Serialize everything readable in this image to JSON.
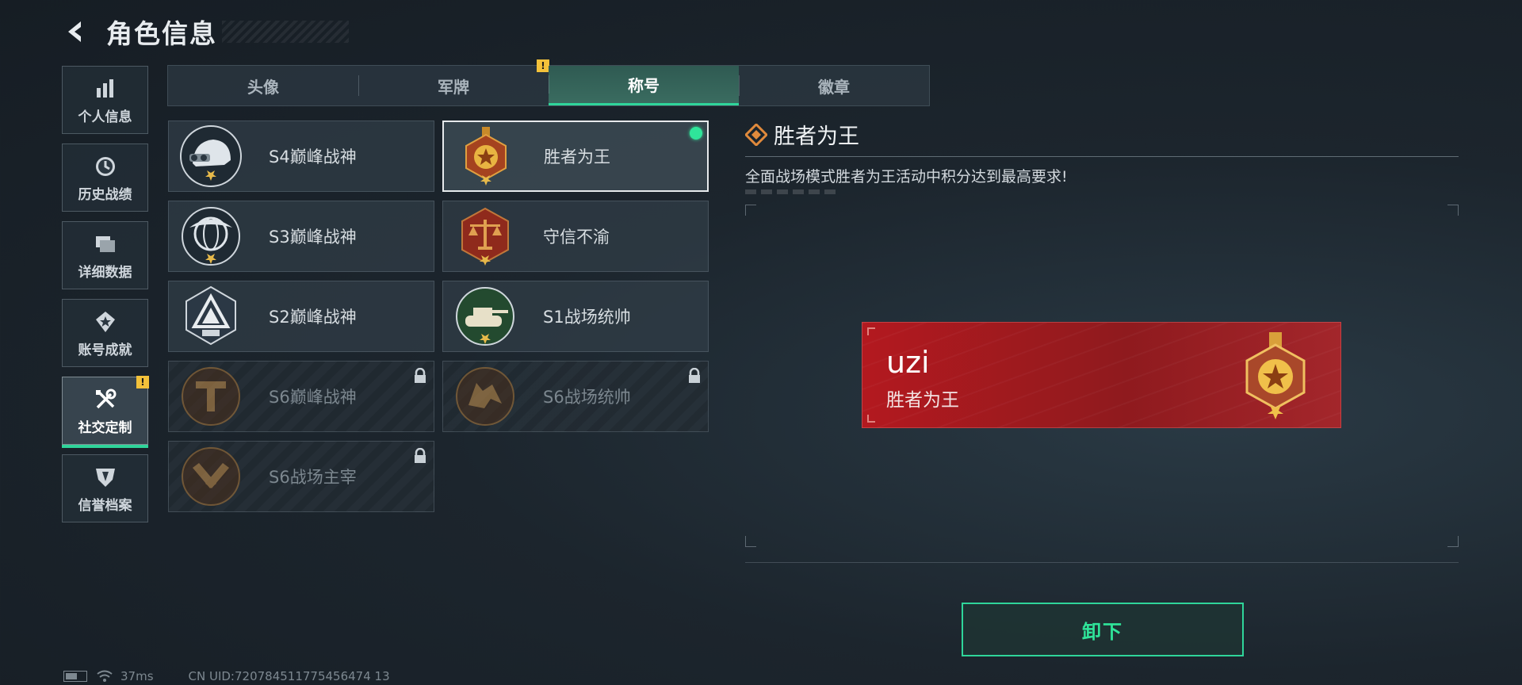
{
  "header": {
    "title": "角色信息"
  },
  "sidenav": {
    "items": [
      {
        "label": "个人信息",
        "icon": "bar-chart-icon",
        "active": false,
        "alert": false
      },
      {
        "label": "历史战绩",
        "icon": "clock-icon",
        "active": false,
        "alert": false
      },
      {
        "label": "详细数据",
        "icon": "folders-icon",
        "active": false,
        "alert": false
      },
      {
        "label": "账号成就",
        "icon": "star-gem-icon",
        "active": false,
        "alert": false
      },
      {
        "label": "社交定制",
        "icon": "tools-icon",
        "active": true,
        "alert": true
      },
      {
        "label": "信誉档案",
        "icon": "shield-icon",
        "active": false,
        "alert": false
      }
    ]
  },
  "tabs": [
    {
      "label": "头像",
      "active": false,
      "alert": false
    },
    {
      "label": "军牌",
      "active": false,
      "alert": true
    },
    {
      "label": "称号",
      "active": true,
      "alert": false
    },
    {
      "label": "徽章",
      "active": false,
      "alert": false
    }
  ],
  "alert_symbol": "!",
  "titles": [
    {
      "label": "S4巅峰战神",
      "emblem": "helmet-emblem-icon",
      "locked": false,
      "selected": false
    },
    {
      "label": "胜者为王",
      "emblem": "gold-medal-emblem-icon",
      "locked": false,
      "selected": true,
      "equipped": true
    },
    {
      "label": "S3巅峰战神",
      "emblem": "globe-eagle-emblem-icon",
      "locked": false,
      "selected": false
    },
    {
      "label": "守信不渝",
      "emblem": "scales-emblem-icon",
      "locked": false,
      "selected": false
    },
    {
      "label": "S2巅峰战神",
      "emblem": "pyramid-emblem-icon",
      "locked": false,
      "selected": false
    },
    {
      "label": "S1战场统帅",
      "emblem": "tank-emblem-icon",
      "locked": false,
      "selected": false
    },
    {
      "label": "S6巅峰战神",
      "emblem": "t-shield-emblem-icon",
      "locked": true,
      "selected": false
    },
    {
      "label": "S6战场统帅",
      "emblem": "wolf-emblem-icon",
      "locked": true,
      "selected": false
    },
    {
      "label": "S6战场主宰",
      "emblem": "crossed-arms-emblem-icon",
      "locked": true,
      "selected": false
    }
  ],
  "detail": {
    "title": "胜者为王",
    "description": "全面战场模式胜者为王活动中积分达到最高要求!"
  },
  "nameplate": {
    "player": "uzi",
    "title": "胜者为王"
  },
  "unequip_button": "卸下",
  "status": {
    "ping": "37ms",
    "uid": "CN UID:720784511775456474 13"
  },
  "colors": {
    "accent": "#2fd59a",
    "alert": "#f3c13a",
    "nameplate": "#b3191f"
  }
}
